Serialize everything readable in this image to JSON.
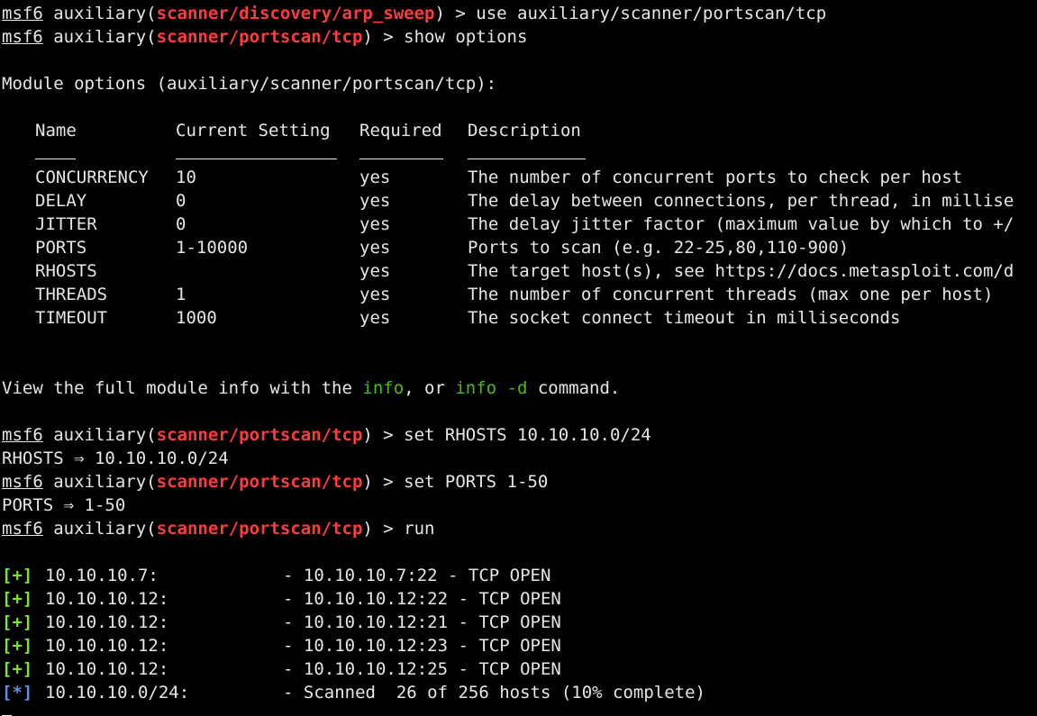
{
  "prompt_user": "msf6",
  "prompt_word": "auxiliary",
  "commands": [
    {
      "module": "scanner/discovery/arp_sweep",
      "cmd": "use auxiliary/scanner/portscan/tcp"
    },
    {
      "module": "scanner/portscan/tcp",
      "cmd": "show options"
    },
    {
      "module": "scanner/portscan/tcp",
      "cmd": "set RHOSTS 10.10.10.0/24"
    },
    {
      "module": "scanner/portscan/tcp",
      "cmd": "set PORTS 1-50"
    },
    {
      "module": "scanner/portscan/tcp",
      "cmd": "run"
    }
  ],
  "module_options_heading": "Module options (auxiliary/scanner/portscan/tcp):",
  "table": {
    "headers": [
      "Name",
      "Current Setting",
      "Required",
      "Description"
    ],
    "rows": [
      {
        "name": "CONCURRENCY",
        "setting": "10",
        "required": "yes",
        "description": "The number of concurrent ports to check per host"
      },
      {
        "name": "DELAY",
        "setting": "0",
        "required": "yes",
        "description": "The delay between connections, per thread, in millise"
      },
      {
        "name": "JITTER",
        "setting": "0",
        "required": "yes",
        "description": "The delay jitter factor (maximum value by which to +/"
      },
      {
        "name": "PORTS",
        "setting": "1-10000",
        "required": "yes",
        "description": "Ports to scan (e.g. 22-25,80,110-900)"
      },
      {
        "name": "RHOSTS",
        "setting": "",
        "required": "yes",
        "description": "The target host(s), see https://docs.metasploit.com/d"
      },
      {
        "name": "THREADS",
        "setting": "1",
        "required": "yes",
        "description": "The number of concurrent threads (max one per host)"
      },
      {
        "name": "TIMEOUT",
        "setting": "1000",
        "required": "yes",
        "description": "The socket connect timeout in milliseconds"
      }
    ]
  },
  "info_line": {
    "pre": "View the full module info with the ",
    "cmd1": "info",
    "mid": ", or ",
    "cmd2": "info -d",
    "post": " command."
  },
  "set_outputs": [
    "RHOSTS ⇒ 10.10.10.0/24",
    "PORTS ⇒ 1-50"
  ],
  "results": [
    {
      "tag": "[+]",
      "host": "10.10.10.7:",
      "msg": "- 10.10.10.7:22 - TCP OPEN"
    },
    {
      "tag": "[+]",
      "host": "10.10.10.12:",
      "msg": "- 10.10.10.12:22 - TCP OPEN"
    },
    {
      "tag": "[+]",
      "host": "10.10.10.12:",
      "msg": "- 10.10.10.12:21 - TCP OPEN"
    },
    {
      "tag": "[+]",
      "host": "10.10.10.12:",
      "msg": "- 10.10.10.12:23 - TCP OPEN"
    },
    {
      "tag": "[+]",
      "host": "10.10.10.12:",
      "msg": "- 10.10.10.12:25 - TCP OPEN"
    },
    {
      "tag": "[*]",
      "host": "10.10.10.0/24:",
      "msg": "- Scanned  26 of 256 hosts (10% complete)"
    }
  ],
  "colors": {
    "background": "#000000",
    "text": "#e6e6e6",
    "module": "#ff3c3c",
    "info_cmd": "#4cbb17",
    "success_tag": "#7ee03b",
    "status_tag": "#5a8fe6"
  }
}
